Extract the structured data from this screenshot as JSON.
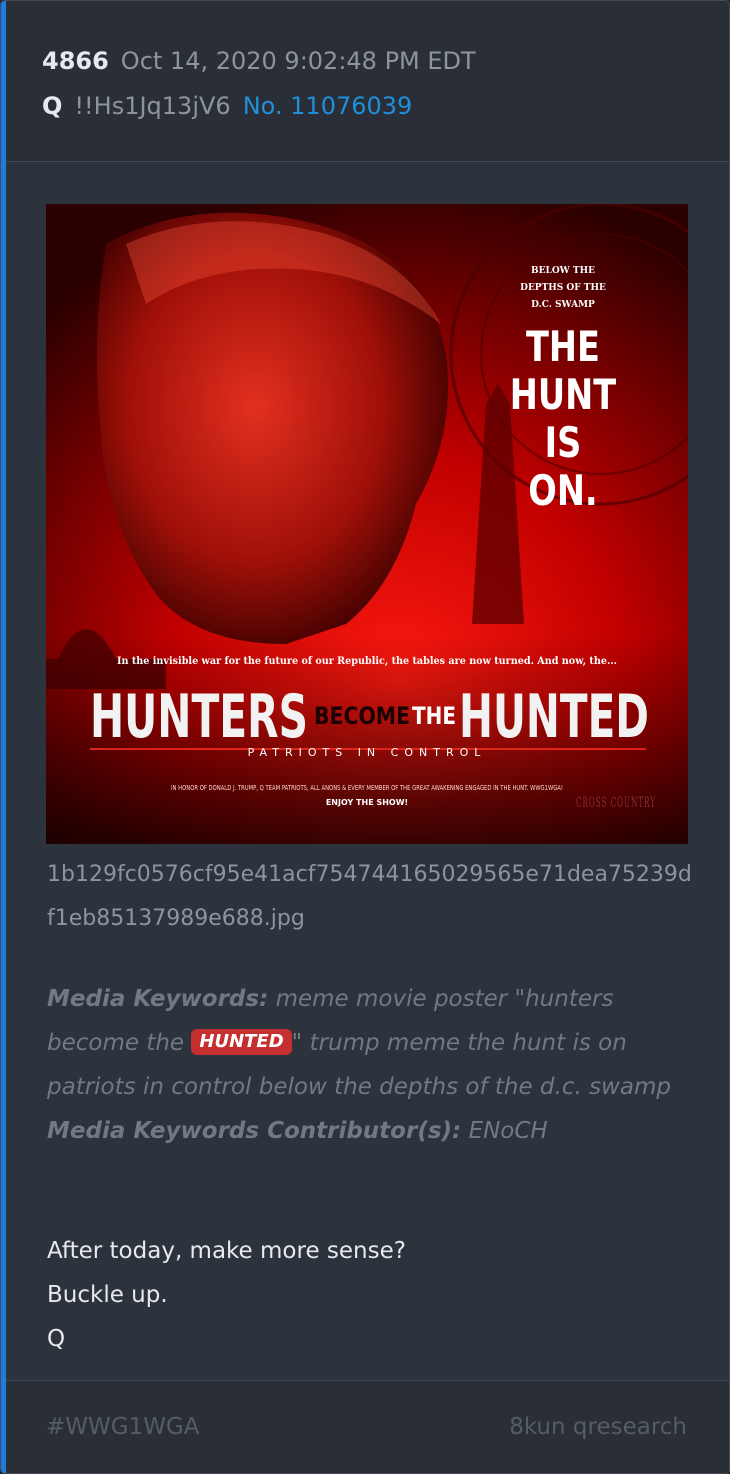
{
  "post": {
    "number": "4866",
    "date": "Oct 14, 2020 9:02:48 PM EDT",
    "author": "Q",
    "tripcode": "!!Hs1Jq13jV6",
    "ref_link": "No. 11076039"
  },
  "colors": {
    "accent": "#1e7be0",
    "link": "#1f8fdb",
    "highlight": "#c62f2f"
  },
  "image": {
    "filename": "1b129fc0576cf95e41acf754744165029565e71dea75239df1eb85137989e688.jpg",
    "tagline_small": [
      "BELOW THE",
      "DEPTHS OF THE",
      "D.C. SWAMP"
    ],
    "tagline_big": [
      "THE",
      "HUNT",
      "IS",
      "ON."
    ],
    "intro_line": "In the invisible war for the future of our Republic, the tables are now turned. And now, the...",
    "title_left": "HUNTERS",
    "title_mid1": "BECOME",
    "title_mid2": "THE",
    "title_right": "HUNTED",
    "subtitle": "PATRIOTS IN CONTROL",
    "dedication": "IN HONOR OF DONALD J. TRUMP, Q TEAM PATRIOTS, ALL ANONS & EVERY MEMBER OF THE GREAT AWAKENING ENGAGED IN THE HUNT. WWG1WGA!",
    "enjoy": "ENJOY THE SHOW!",
    "logo": "CROSS COUNTRY"
  },
  "keywords": {
    "label": "Media Keywords:",
    "text_before": "meme movie poster \"hunters become the",
    "highlight": "HUNTED",
    "text_after": "\" trump meme the hunt is on patriots in control below the depths of the d.c. swamp",
    "contributor_label": "Media Keywords Contributor(s):",
    "contributor": "ENoCH"
  },
  "message": {
    "lines": [
      "After today, make more sense?",
      "Buckle up.",
      "Q"
    ]
  },
  "footer": {
    "hashtag": "#WWG1WGA",
    "source": "8kun qresearch"
  }
}
